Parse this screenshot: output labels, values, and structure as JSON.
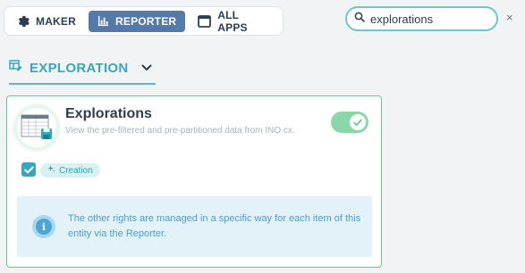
{
  "app_switcher": {
    "items": [
      {
        "label": "MAKER",
        "icon": "gear-icon",
        "active": false
      },
      {
        "label": "REPORTER",
        "icon": "bar-chart-icon",
        "active": true
      },
      {
        "label": "ALL APPS",
        "icon": "window-icon",
        "active": false
      }
    ]
  },
  "search": {
    "value": "explorations",
    "clear_label": "×"
  },
  "section": {
    "title": "EXPLORATION",
    "icon": "table-edit-icon"
  },
  "card": {
    "title": "Explorations",
    "description": "View the pre-filtered and pre-partitioned data from INO cx.",
    "enabled": true,
    "checked": true,
    "tag_label": "Creation",
    "tag_icon": "sparkle-icon",
    "info_text": "The other rights are managed in a specific way for each item of this entity via the Reporter."
  },
  "colors": {
    "accent": "#3aa7b8",
    "active_app": "#5479ab",
    "card_border": "#5fc98e",
    "toggle_on": "#8ad7aa",
    "info_bg": "#e2f2f8",
    "info_text": "#4f9cc9"
  }
}
